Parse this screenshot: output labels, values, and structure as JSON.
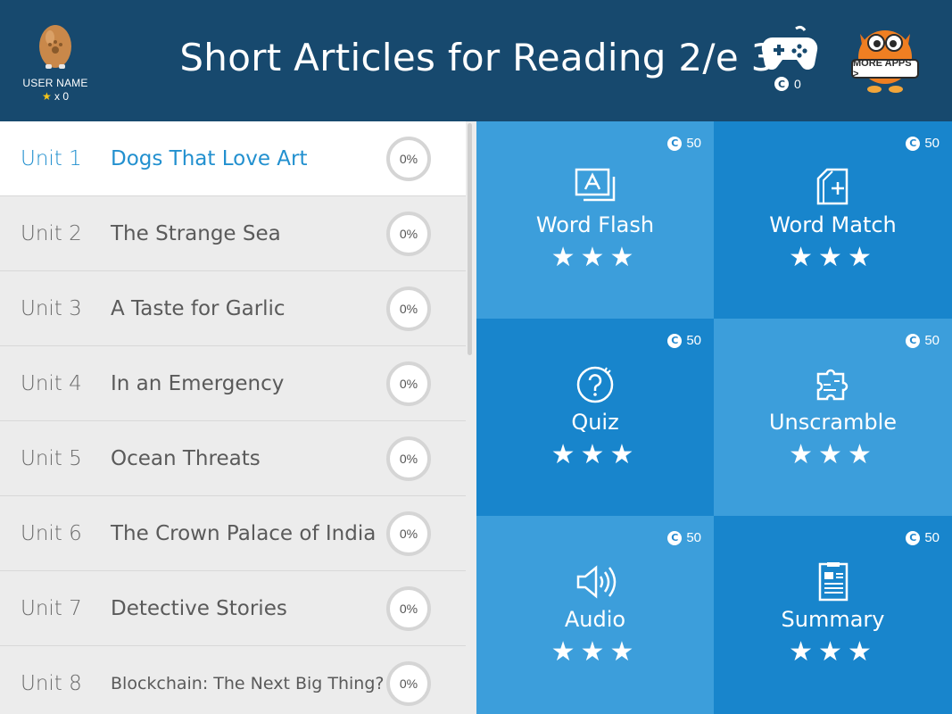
{
  "header": {
    "title": "Short Articles for Reading 2/e 3",
    "user_name": "USER NAME",
    "user_star_count": "x 0",
    "game_coins": "0",
    "more_apps_label": "MORE APPS >"
  },
  "units": [
    {
      "num": "Unit 1",
      "title": "Dogs That Love Art",
      "progress": "0%",
      "active": true
    },
    {
      "num": "Unit 2",
      "title": "The Strange Sea",
      "progress": "0%"
    },
    {
      "num": "Unit 3",
      "title": "A Taste for Garlic",
      "progress": "0%"
    },
    {
      "num": "Unit 4",
      "title": "In an Emergency",
      "progress": "0%"
    },
    {
      "num": "Unit 5",
      "title": "Ocean Threats",
      "progress": "0%"
    },
    {
      "num": "Unit 6",
      "title": "The Crown Palace of India",
      "progress": "0%"
    },
    {
      "num": "Unit 7",
      "title": "Detective Stories",
      "progress": "0%"
    },
    {
      "num": "Unit 8",
      "title": "Blockchain: The Next Big Thing?",
      "progress": "0%"
    }
  ],
  "activities": [
    {
      "label": "Word Flash",
      "coins": "50",
      "icon": "word-flash-icon",
      "stars": "★★★"
    },
    {
      "label": "Word Match",
      "coins": "50",
      "icon": "word-match-icon",
      "stars": "★★★"
    },
    {
      "label": "Quiz",
      "coins": "50",
      "icon": "quiz-icon",
      "stars": "★★★"
    },
    {
      "label": "Unscramble",
      "coins": "50",
      "icon": "puzzle-icon",
      "stars": "★★★"
    },
    {
      "label": "Audio",
      "coins": "50",
      "icon": "speaker-icon",
      "stars": "★★★"
    },
    {
      "label": "Summary",
      "coins": "50",
      "icon": "summary-icon",
      "stars": "★★★"
    }
  ],
  "coin_symbol": "C",
  "colors": {
    "header_bg": "#17496e",
    "accent": "#2290cf",
    "tile_light": "#3c9edb",
    "tile_dark": "#1885cc"
  }
}
